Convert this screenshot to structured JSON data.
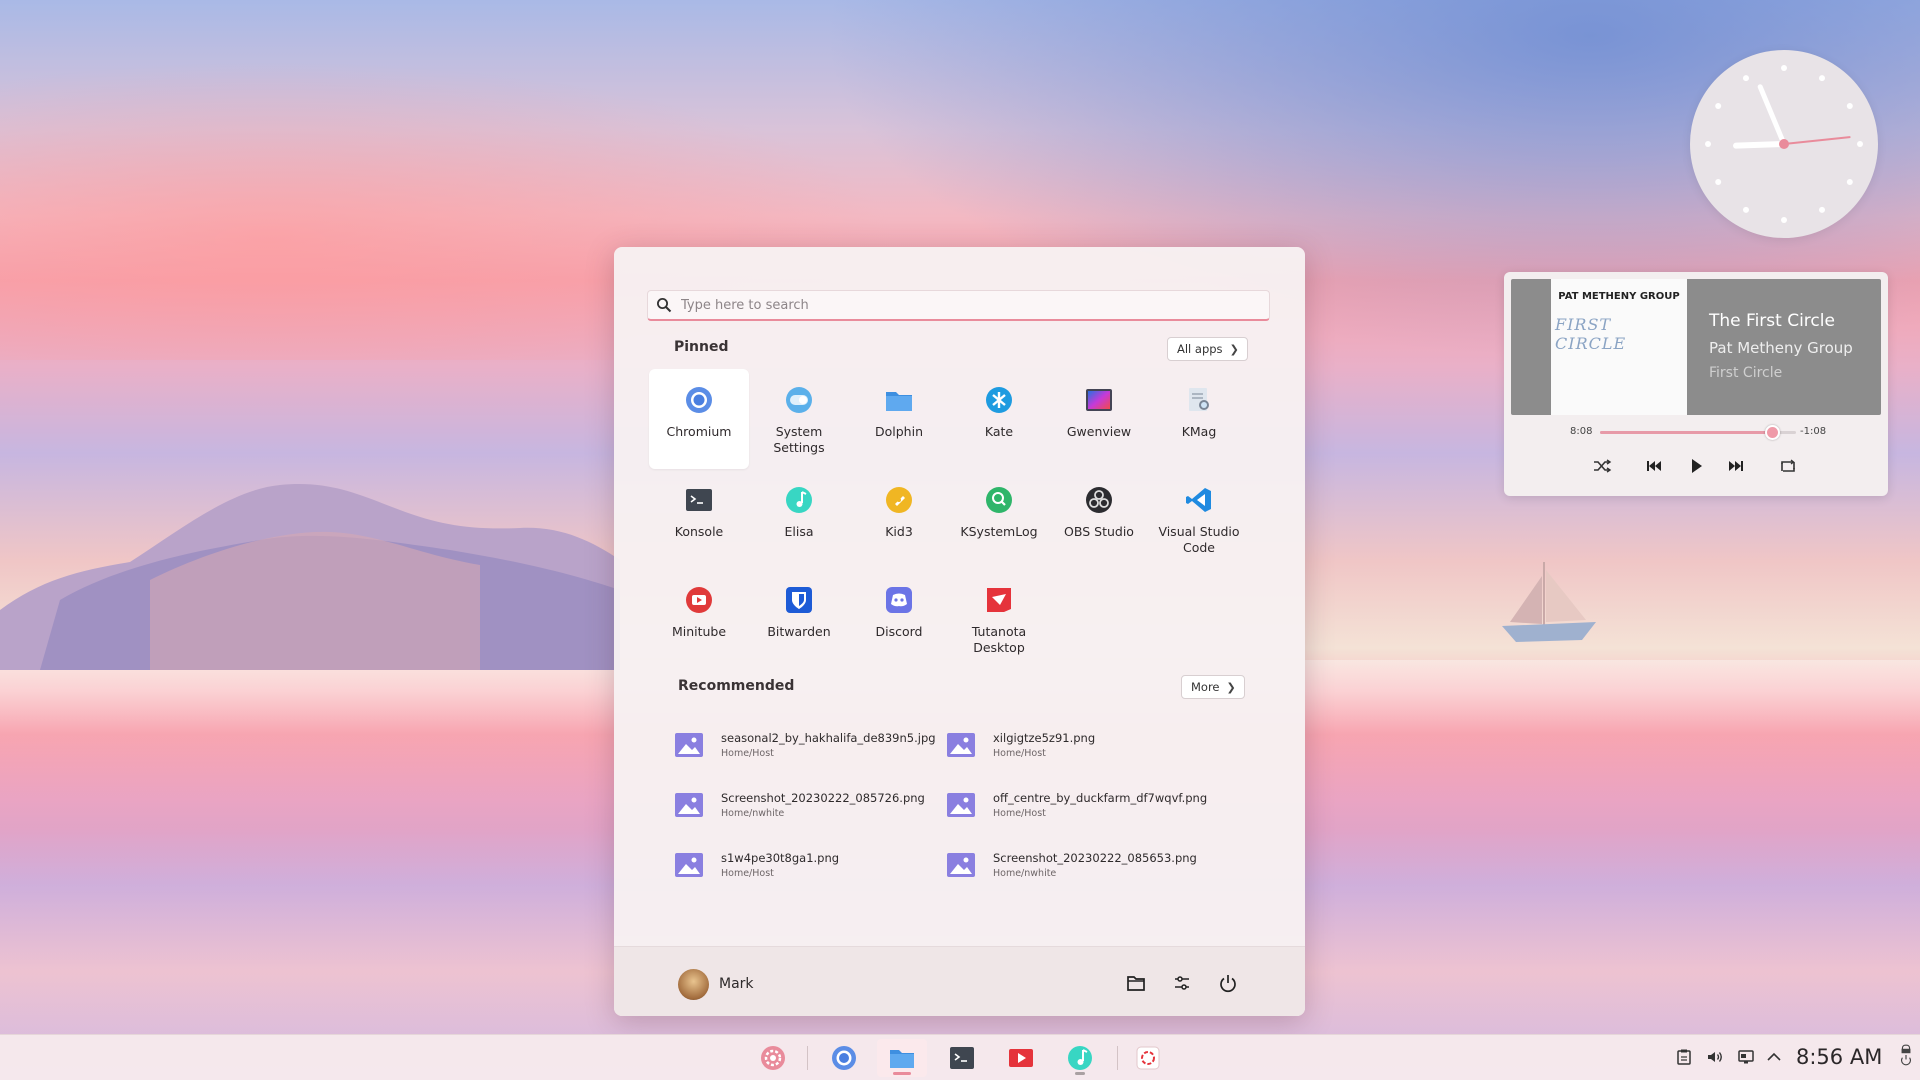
{
  "start_menu": {
    "search": {
      "placeholder": "Type here to search",
      "value": ""
    },
    "pinned_title": "Pinned",
    "all_apps_label": "All apps",
    "pinned_apps": [
      {
        "label": "Chromium",
        "icon": "chromium-icon",
        "selected": true
      },
      {
        "label": "System Settings",
        "icon": "settings-toggle-icon"
      },
      {
        "label": "Dolphin",
        "icon": "folder-icon"
      },
      {
        "label": "Kate",
        "icon": "kate-icon"
      },
      {
        "label": "Gwenview",
        "icon": "gwenview-icon"
      },
      {
        "label": "KMag",
        "icon": "kmag-icon"
      },
      {
        "label": "Konsole",
        "icon": "terminal-icon"
      },
      {
        "label": "Elisa",
        "icon": "music-note-icon"
      },
      {
        "label": "Kid3",
        "icon": "kid3-icon"
      },
      {
        "label": "KSystemLog",
        "icon": "ksystemlog-icon"
      },
      {
        "label": "OBS Studio",
        "icon": "obs-icon"
      },
      {
        "label": "Visual Studio Code",
        "icon": "vscode-icon"
      },
      {
        "label": "Minitube",
        "icon": "minitube-icon"
      },
      {
        "label": "Bitwarden",
        "icon": "bitwarden-icon"
      },
      {
        "label": "Discord",
        "icon": "discord-icon"
      },
      {
        "label": "Tutanota Desktop",
        "icon": "tutanota-icon"
      }
    ],
    "recommended_title": "Recommended",
    "more_label": "More",
    "recommended": [
      {
        "name": "seasonal2_by_hakhalifa_de839n5.jpg",
        "path": "Home/Host"
      },
      {
        "name": "xilgigtze5z91.png",
        "path": "Home/Host"
      },
      {
        "name": "Screenshot_20230222_085726.png",
        "path": "Home/nwhite"
      },
      {
        "name": "off_centre_by_duckfarm_df7wqvf.png",
        "path": "Home/Host"
      },
      {
        "name": "s1w4pe30t8ga1.png",
        "path": "Home/Host"
      },
      {
        "name": "Screenshot_20230222_085653.png",
        "path": "Home/nwhite"
      }
    ],
    "user_name": "Mark",
    "footer_buttons": [
      "folder-icon",
      "sliders-icon",
      "power-icon"
    ]
  },
  "clock_widget": {
    "hour": 8,
    "minute": 56,
    "second": 14
  },
  "media_player": {
    "album_artist_art": "PAT METHENY GROUP",
    "album_title_art": "FIRST CIRCLE",
    "track_title": "The First Circle",
    "artist": "Pat Metheny Group",
    "album": "First Circle",
    "elapsed": "8:08",
    "remaining": "-1:08",
    "progress": 0.88
  },
  "taskbar": {
    "items": [
      "settings-gear-icon",
      "chromium-icon",
      "dolphin-icon",
      "konsole-icon",
      "minitube-icon",
      "elisa-icon",
      "tutanota-icon"
    ],
    "active_item": "dolphin-icon",
    "clock": "8:56 AM"
  },
  "colors": {
    "accent": "#e98b9b",
    "menu_bg": "#f7f0f1"
  }
}
